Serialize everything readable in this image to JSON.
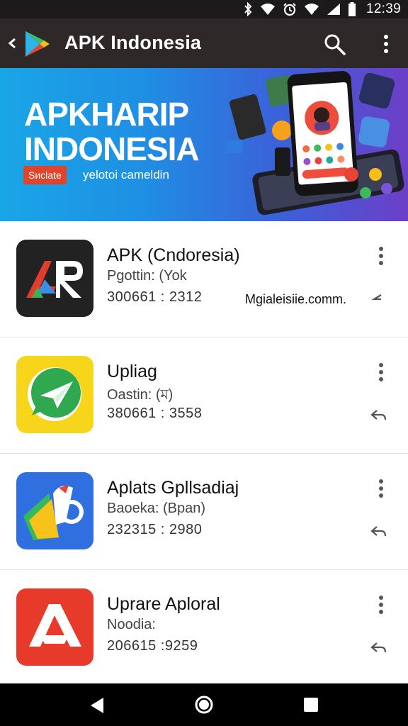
{
  "status_bar": {
    "time": "12:39",
    "icons": [
      "bluetooth-icon",
      "wifi-icon",
      "alarm-icon",
      "wifi-signal-icon",
      "cell-signal-icon",
      "battery-icon"
    ]
  },
  "app_bar": {
    "title": "APK Indonesia",
    "icons": [
      "back-icon",
      "play-store-logo",
      "search-icon",
      "more-vert-icon"
    ]
  },
  "banner": {
    "title_line1": "AРKHARIP",
    "title_line2": "INDONESIA",
    "badge": "Sиclate",
    "subtitle": "yelotoi cameldin"
  },
  "apps": [
    {
      "name": "APK (Cndoresia)",
      "meta1": "Pgottin: (Yok",
      "meta2": "300661 : 2312",
      "link": "Mgialeisiie.comm.",
      "icon": "apk-logo-icon",
      "colors": {
        "bg": "#222222"
      }
    },
    {
      "name": "Upliag",
      "meta1": "Oastin: (ম)",
      "meta2": "380661 : 3558",
      "link": "",
      "icon": "paper-plane-chat-icon",
      "colors": {
        "bg": "#f6d51a"
      }
    },
    {
      "name": "Aplats Gpllsadiaj",
      "meta1": "Baoeka: (Bpan)",
      "meta2": "232315 : 2980",
      "link": "",
      "icon": "folder-bird-icon",
      "colors": {
        "bg": "#2f6fe0"
      }
    },
    {
      "name": "Uprare Aploral",
      "meta1": "Noodia:",
      "meta2": "206615 :9259",
      "link": "",
      "icon": "a-letter-icon",
      "colors": {
        "bg": "#e73a2a"
      }
    }
  ],
  "nav_bar": {
    "icons": [
      "nav-back-icon",
      "nav-home-icon",
      "nav-recents-icon"
    ]
  }
}
